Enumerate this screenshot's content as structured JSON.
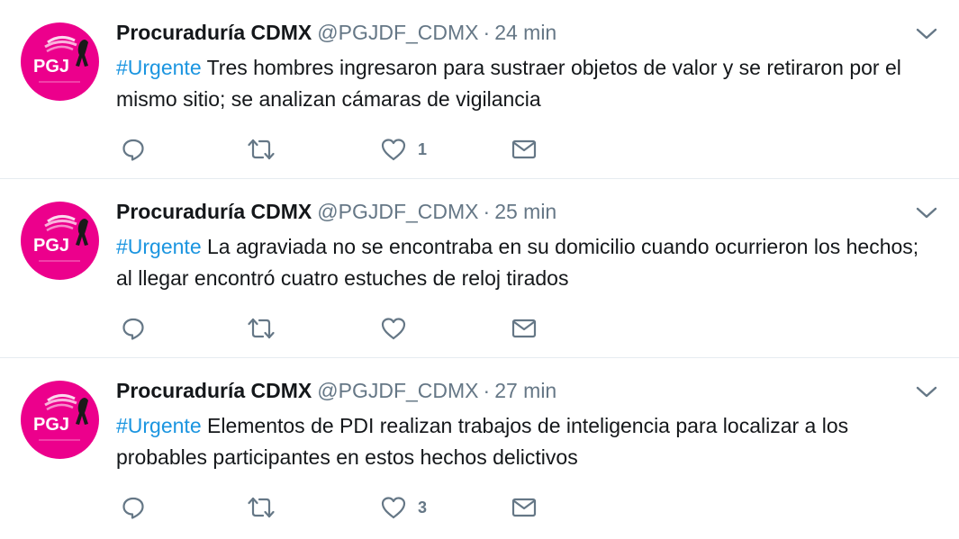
{
  "tweets": [
    {
      "display_name": "Procuraduría CDMX",
      "handle": "@PGJDF_CDMX",
      "separator": "·",
      "time": "24 min",
      "hashtag": "#Urgente",
      "text": " Tres hombres ingresaron para sustraer objetos de valor y se retiraron por el mismo sitio; se analizan cámaras de vigilancia",
      "reply_count": "",
      "retweet_count": "",
      "like_count": "1",
      "avatar_label": "PGJ"
    },
    {
      "display_name": "Procuraduría CDMX",
      "handle": "@PGJDF_CDMX",
      "separator": "·",
      "time": "25 min",
      "hashtag": "#Urgente",
      "text": " La agraviada no se encontraba en su domicilio cuando ocurrieron los hechos; al llegar encontró cuatro estuches de reloj tirados",
      "reply_count": "",
      "retweet_count": "",
      "like_count": "",
      "avatar_label": "PGJ"
    },
    {
      "display_name": "Procuraduría CDMX",
      "handle": "@PGJDF_CDMX",
      "separator": "·",
      "time": "27 min",
      "hashtag": "#Urgente",
      "text": " Elementos de PDI realizan trabajos de inteligencia para localizar a los probables participantes en estos hechos delictivos",
      "reply_count": "",
      "retweet_count": "",
      "like_count": "3",
      "avatar_label": "PGJ"
    }
  ],
  "icons": {
    "reply": "reply-icon",
    "retweet": "retweet-icon",
    "like": "heart-icon",
    "dm": "envelope-icon",
    "caret": "chevron-down-icon"
  },
  "colors": {
    "accent_pink": "#ec008c",
    "link_blue": "#1b95e0",
    "muted": "#657786"
  }
}
